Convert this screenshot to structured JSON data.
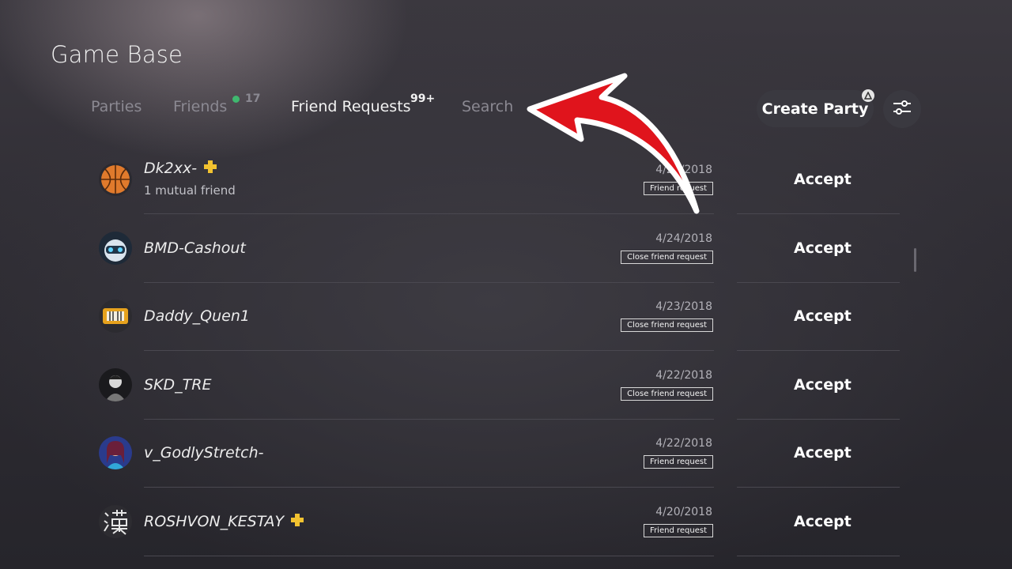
{
  "header": {
    "title": "Game Base"
  },
  "tabs": [
    {
      "label": "Parties"
    },
    {
      "label": "Friends",
      "count": "17"
    },
    {
      "label": "Friend Requests",
      "count": "99+"
    },
    {
      "label": "Search"
    }
  ],
  "actions": {
    "create_party": "Create Party"
  },
  "requests": [
    {
      "name": "Dk2xx-",
      "plus": true,
      "mutual": "1 mutual friend",
      "date": "4/24/2018",
      "type": "Friend request",
      "accept": "Accept"
    },
    {
      "name": "BMD-Cashout",
      "date": "4/24/2018",
      "type": "Close friend request",
      "accept": "Accept"
    },
    {
      "name": "Daddy_Quen1",
      "date": "4/23/2018",
      "type": "Close friend request",
      "accept": "Accept"
    },
    {
      "name": "SKD_TRE",
      "date": "4/22/2018",
      "type": "Close friend request",
      "accept": "Accept"
    },
    {
      "name": "v_GodlyStretch-",
      "date": "4/22/2018",
      "type": "Friend request",
      "accept": "Accept"
    },
    {
      "name": "ROSHVON_KESTAY",
      "plus": true,
      "date": "4/20/2018",
      "type": "Friend request",
      "accept": "Accept"
    }
  ],
  "colors": {
    "accent_online": "#3fb86f",
    "plus_gold": "#f2c230",
    "arrow_red": "#e0141c"
  },
  "icons": [
    "triangle-icon",
    "filter-sliders-icon",
    "playstation-plus-icon",
    "red-arrow-annotation"
  ]
}
